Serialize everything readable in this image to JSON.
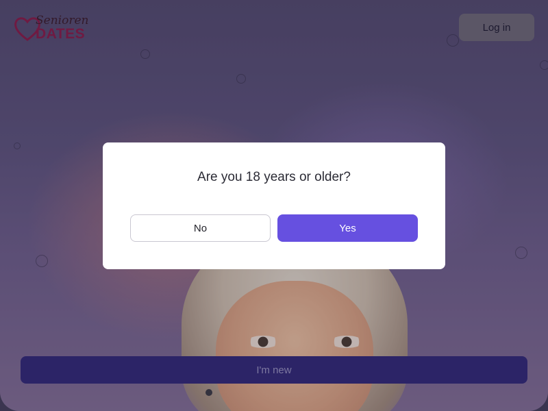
{
  "header": {
    "logo_script": "Senioren",
    "logo_main": "DATES",
    "login_label": "Log in"
  },
  "modal": {
    "question": "Are you 18 years or older?",
    "no_label": "No",
    "yes_label": "Yes"
  },
  "cta": {
    "new_label": "I'm new"
  },
  "colors": {
    "accent": "#6650e0",
    "brand": "#8a1a4a",
    "cta_bg": "#2c2467"
  }
}
